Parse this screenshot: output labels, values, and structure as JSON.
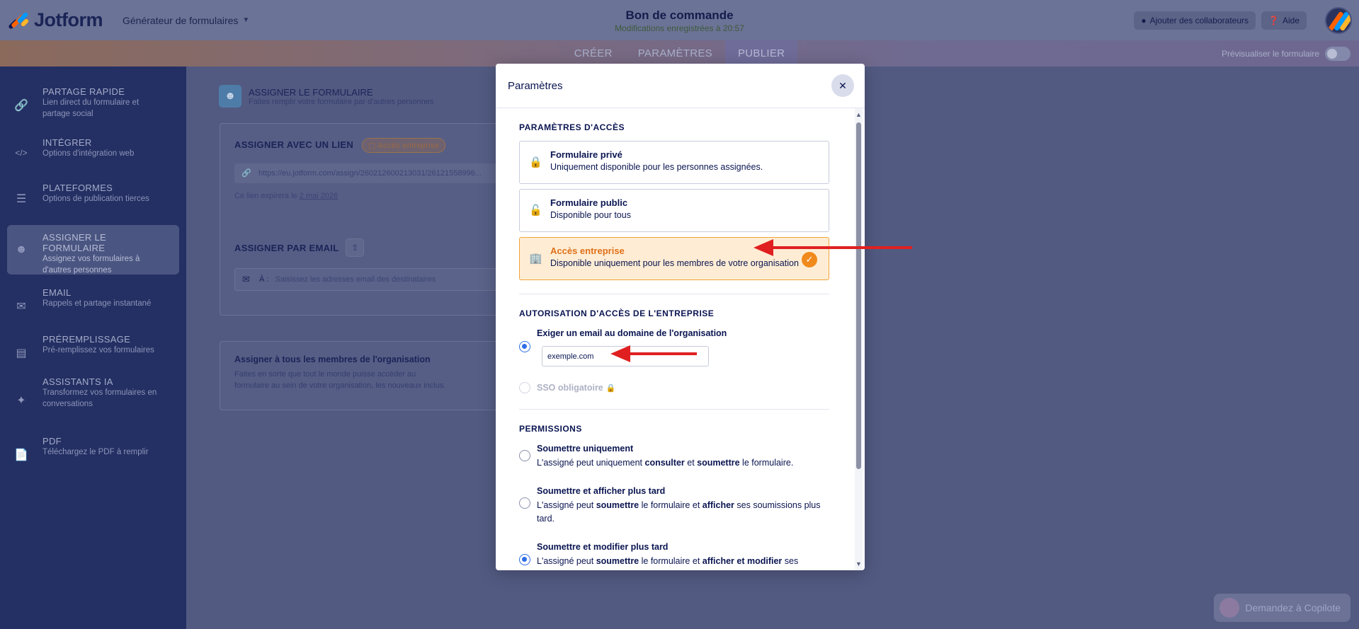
{
  "header": {
    "brand": "Jotform",
    "builder_label": "Générateur de formulaires",
    "form_title": "Bon de commande",
    "saved_status": "Modifications enregistrées à 20:57",
    "add_collaborators": "Ajouter des collaborateurs",
    "help": "Aide"
  },
  "tabs": {
    "items": [
      "CRÉER",
      "PARAMÈTRES",
      "PUBLIER"
    ],
    "active": "PUBLIER",
    "preview_label": "Prévisualiser le formulaire"
  },
  "sidebar": {
    "items": [
      {
        "title": "PARTAGE RAPIDE",
        "desc": "Lien direct du formulaire et partage social",
        "icon": "link-icon"
      },
      {
        "title": "INTÉGRER",
        "desc": "Options d'intégration web",
        "icon": "code-icon"
      },
      {
        "title": "PLATEFORMES",
        "desc": "Options de publication tierces",
        "icon": "layers-icon"
      },
      {
        "title": "ASSIGNER LE FORMULAIRE",
        "desc": "Assignez vos formulaires à d'autres personnes",
        "icon": "users-icon"
      },
      {
        "title": "EMAIL",
        "desc": "Rappels et partage instantané",
        "icon": "mail-icon"
      },
      {
        "title": "PRÉREMPLISSAGE",
        "desc": "Pré-remplissez vos formulaires",
        "icon": "prefill-icon"
      },
      {
        "title": "ASSISTANTS IA",
        "desc": "Transformez vos formulaires en conversations",
        "icon": "sparkle-icon"
      },
      {
        "title": "PDF",
        "desc": "Téléchargez le PDF à remplir",
        "icon": "pdf-icon"
      }
    ],
    "active_index": 3
  },
  "main": {
    "assign_title": "ASSIGNER LE FORMULAIRE",
    "assign_desc": "Faites remplir votre formulaire par d'autres personnes",
    "link_section_title": "ASSIGNER AVEC UN LIEN",
    "link_tag": "Accès entreprise",
    "link_url": "https://eu.jotform.com/assign/260212600213031/26121558996...",
    "expire_prefix": "Ce lien expirera le",
    "expire_date": "2 mai 2026",
    "email_section_title": "ASSIGNER PAR EMAIL",
    "email_to_label": "À :",
    "email_placeholder": "Saisissez les adresses email des destinataires",
    "org_title": "Assigner à tous les membres de l'organisation",
    "org_desc_1": "Faites en sorte que tout le monde puisse accéder au",
    "org_desc_2": "formulaire au sein de votre organisation, les nouveaux inclus."
  },
  "copilot_label": "Demandez à Copilote",
  "modal": {
    "title": "Paramètres",
    "access_section": "PARAMÈTRES D'ACCÈS",
    "access_options": [
      {
        "title": "Formulaire privé",
        "desc": "Uniquement disponible pour les personnes assignées.",
        "icon": "lock-icon"
      },
      {
        "title": "Formulaire public",
        "desc": "Disponible pour tous",
        "icon": "unlock-icon"
      },
      {
        "title": "Accès entreprise",
        "desc": "Disponible uniquement pour les membres de votre organisation",
        "icon": "building-icon"
      }
    ],
    "access_selected": 2,
    "auth_section": "AUTORISATION D'ACCÈS DE L'ENTREPRISE",
    "auth_options": [
      {
        "title": "Exiger un email au domaine de l'organisation",
        "selected": true
      },
      {
        "title": "SSO obligatoire",
        "selected": false,
        "disabled": true
      }
    ],
    "domain_value": "exemple.com",
    "permissions_section": "PERMISSIONS",
    "perm_1_title": "Soumettre uniquement",
    "perm_1_desc": [
      "L'assigné peut uniquement ",
      "consulter",
      " et ",
      "soumettre",
      " le formulaire."
    ],
    "perm_2_title": "Soumettre et afficher plus tard",
    "perm_2_desc": [
      "L'assigné peut ",
      "soumettre",
      " le formulaire et ",
      "afficher",
      " ses soumissions plus tard."
    ],
    "perm_3_title": "Soumettre et modifier plus tard",
    "perm_3_desc": [
      "L'assigné peut ",
      "soumettre",
      " le formulaire et ",
      "afficher et modifier",
      " ses"
    ],
    "perm_selected": 3
  },
  "colors": {
    "accent_orange": "#f08a1c",
    "selected_bg": "#feedd4",
    "radio_blue": "#2f6ee8",
    "arrow_red": "#e02020"
  }
}
